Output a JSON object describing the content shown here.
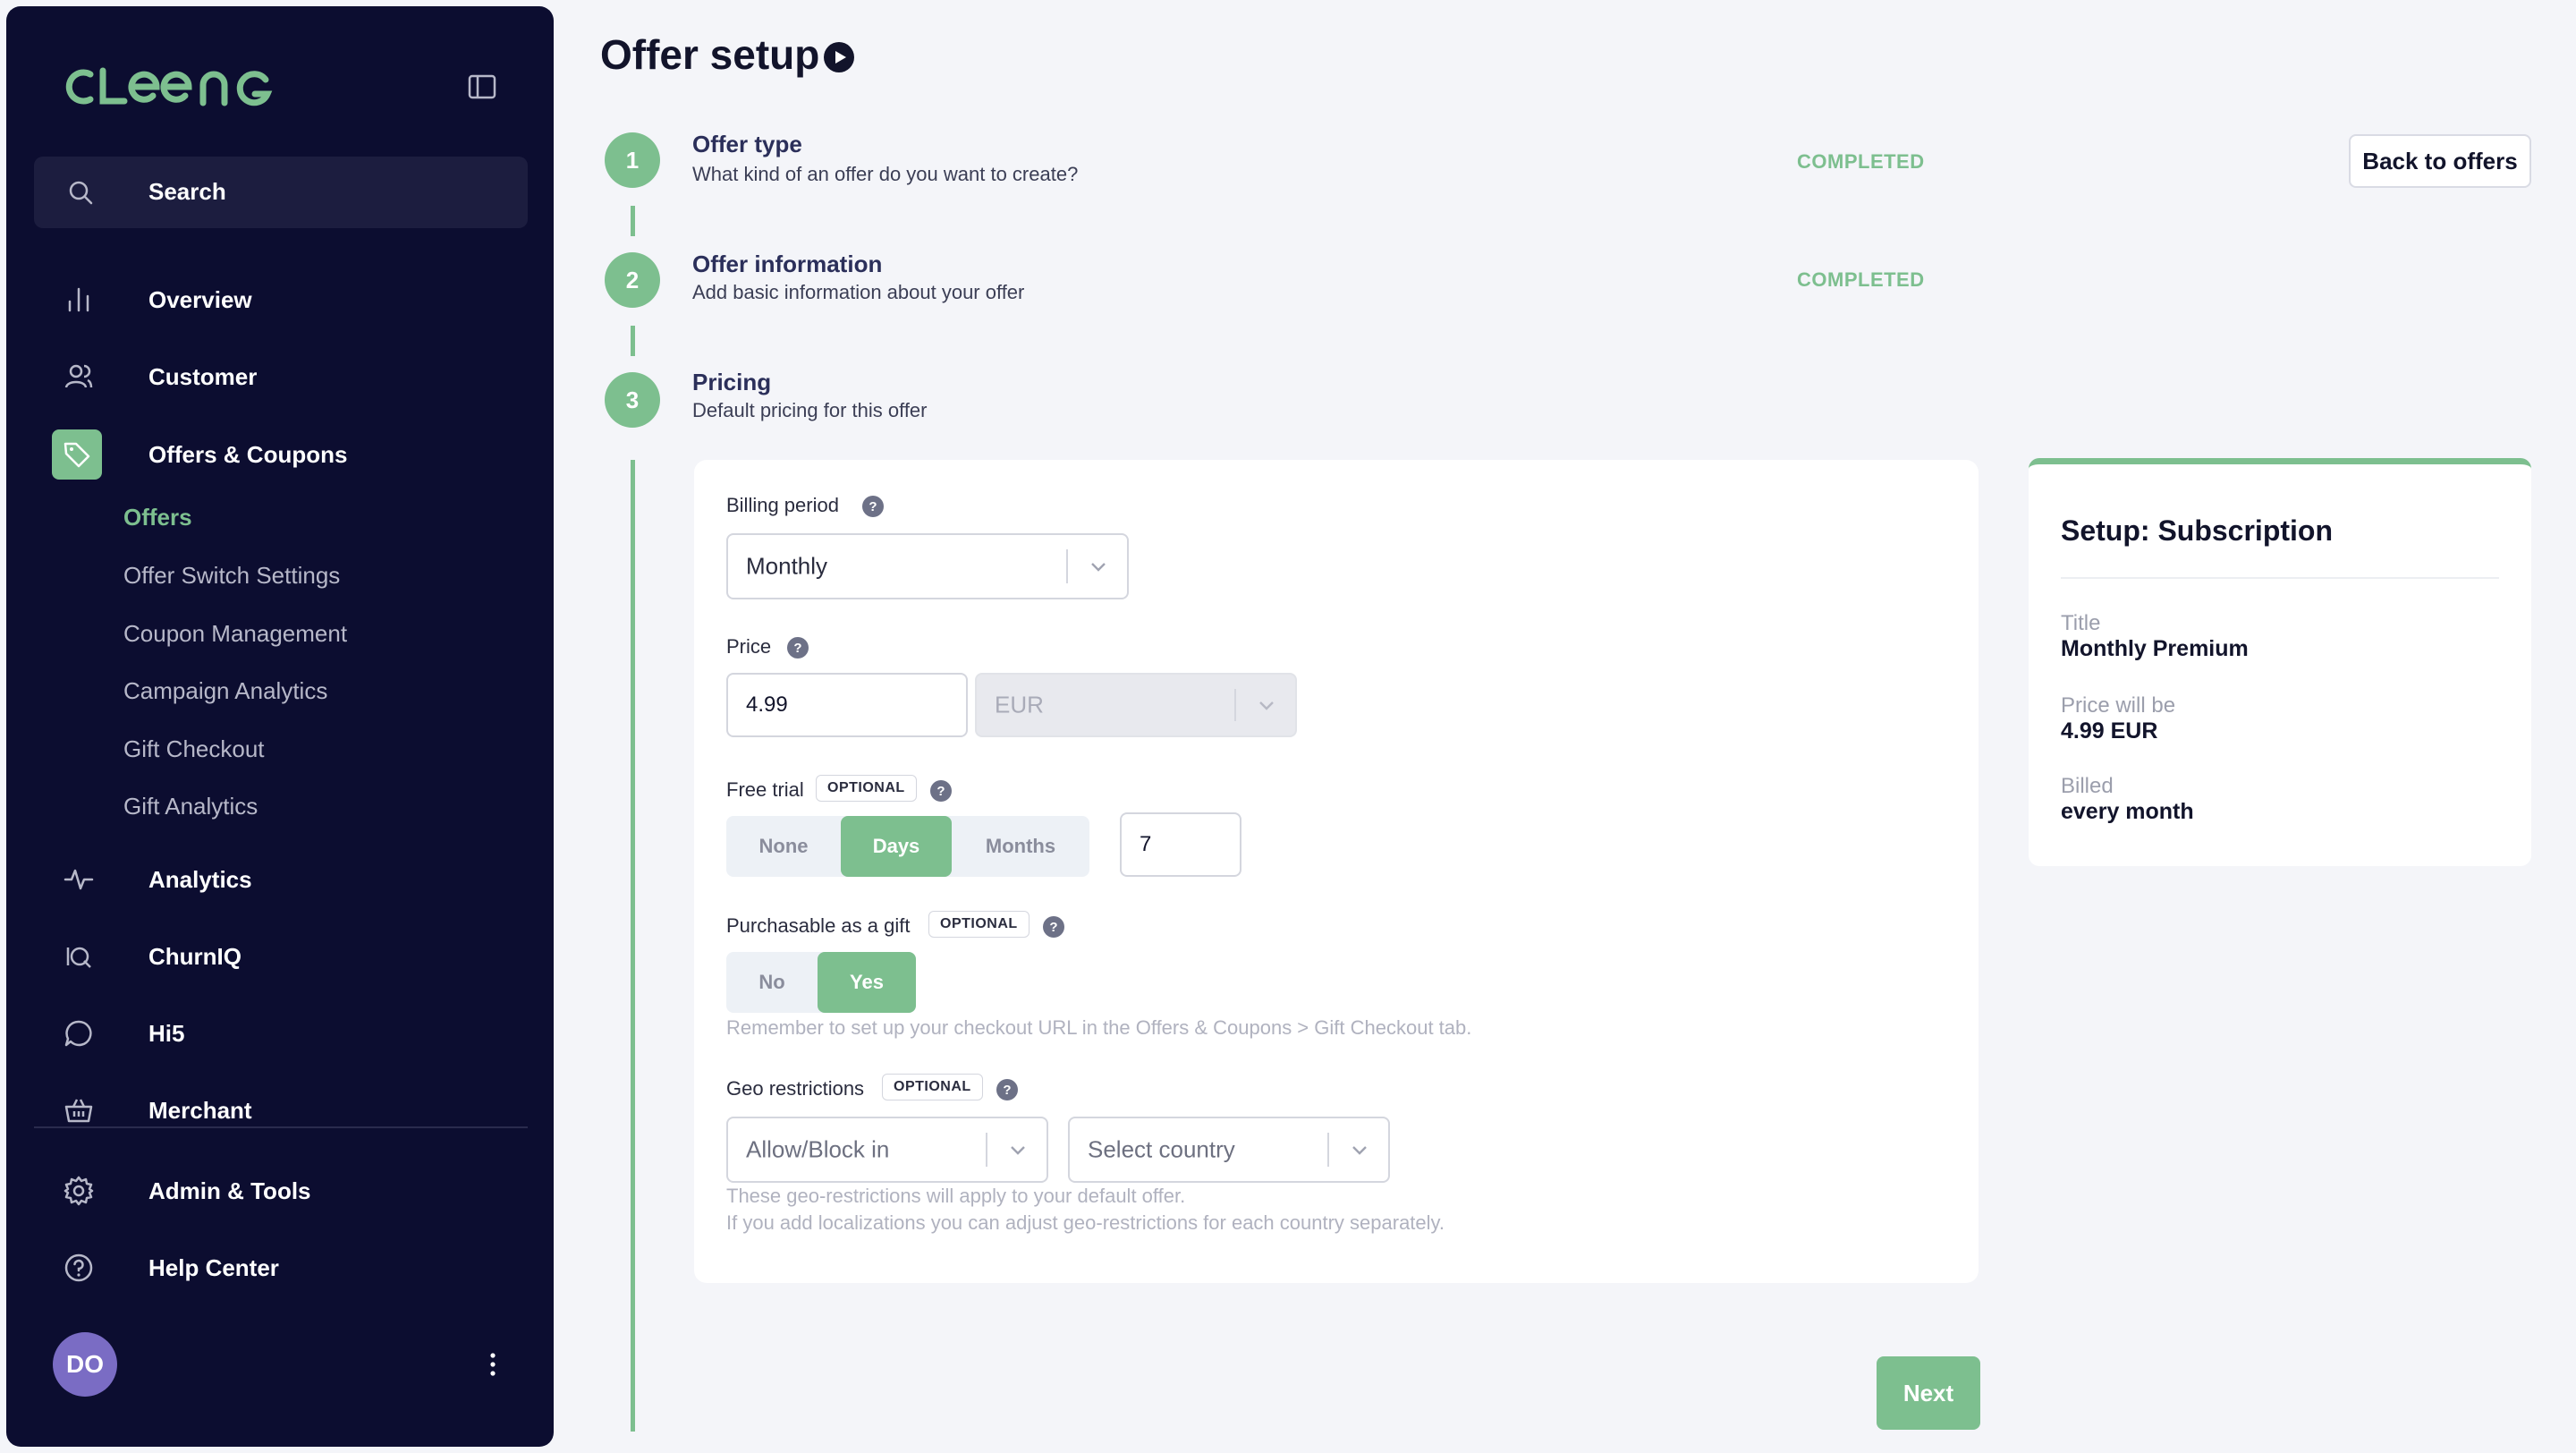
{
  "app": {
    "logo_text": "CLEENG"
  },
  "sidebar": {
    "search_label": "Search",
    "items": {
      "overview": "Overview",
      "customer": "Customer",
      "offers_coupons": "Offers & Coupons",
      "analytics": "Analytics",
      "churniq": "ChurnIQ",
      "hi5": "Hi5",
      "merchant": "Merchant",
      "admin_tools": "Admin & Tools",
      "help_center": "Help Center"
    },
    "sub_items": {
      "offers": "Offers",
      "offer_switch": "Offer Switch Settings",
      "coupon_management": "Coupon Management",
      "campaign_analytics": "Campaign Analytics",
      "gift_checkout": "Gift Checkout",
      "gift_analytics": "Gift Analytics"
    },
    "avatar_initials": "DO"
  },
  "header": {
    "title": "Offer setup",
    "back_button": "Back to offers"
  },
  "steps": [
    {
      "number": "1",
      "title": "Offer type",
      "description": "What kind of an offer do you want to create?",
      "status": "COMPLETED"
    },
    {
      "number": "2",
      "title": "Offer information",
      "description": "Add basic information about your offer",
      "status": "COMPLETED"
    },
    {
      "number": "3",
      "title": "Pricing",
      "description": "Default pricing for this offer",
      "status": ""
    }
  ],
  "form": {
    "billing_period": {
      "label": "Billing period",
      "value": "Monthly"
    },
    "price": {
      "label": "Price",
      "value": "4.99",
      "currency": "EUR"
    },
    "free_trial": {
      "label": "Free trial",
      "badge": "OPTIONAL",
      "options": [
        "None",
        "Days",
        "Months"
      ],
      "selected": "Days",
      "value": "7"
    },
    "gift": {
      "label": "Purchasable as a gift",
      "badge": "OPTIONAL",
      "options": [
        "No",
        "Yes"
      ],
      "selected": "Yes",
      "hint": "Remember to set up your checkout URL in the Offers & Coupons > Gift Checkout tab."
    },
    "geo": {
      "label": "Geo restrictions",
      "badge": "OPTIONAL",
      "mode_placeholder": "Allow/Block in",
      "country_placeholder": "Select country",
      "hint_line1": "These geo-restrictions will apply to your default offer.",
      "hint_line2": "If you add localizations you can adjust geo-restrictions for each country separately."
    },
    "next_button": "Next"
  },
  "summary": {
    "heading": "Setup: Subscription",
    "title_label": "Title",
    "title_value": "Monthly Premium",
    "price_label": "Price will be",
    "price_value": "4.99 EUR",
    "billed_label": "Billed",
    "billed_value": "every month"
  },
  "colors": {
    "sidebar_bg": "#0c0d30",
    "accent": "#7dbf8f",
    "page_bg": "#f4f5f9"
  }
}
